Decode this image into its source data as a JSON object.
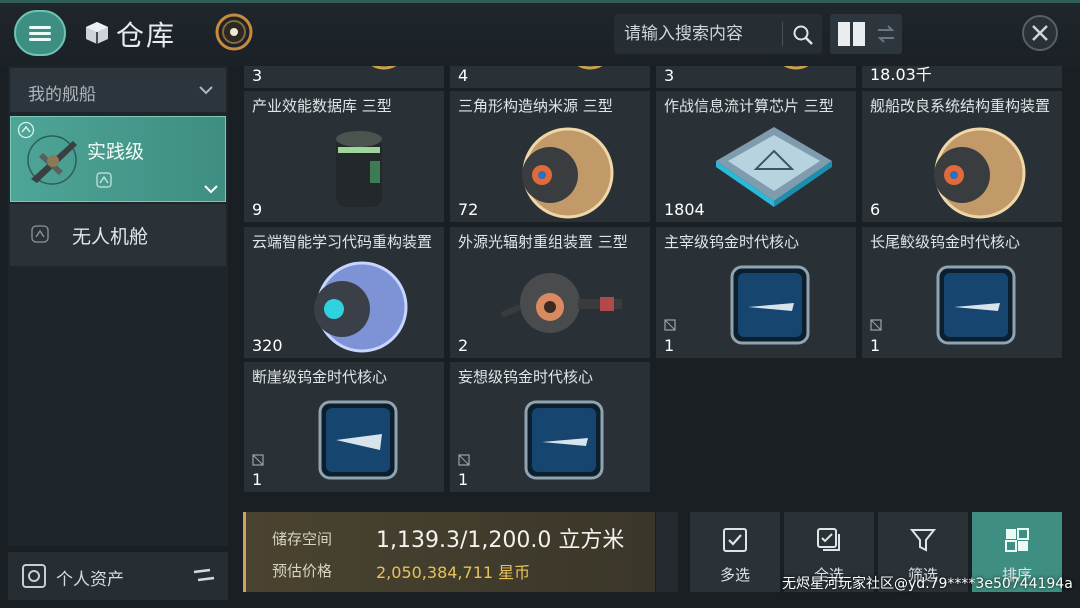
{
  "header": {
    "title": "仓库",
    "search_placeholder": "请输入搜索内容"
  },
  "sidebar": {
    "category_label": "我的舰船",
    "items": [
      {
        "label": "实践级",
        "selected": true
      },
      {
        "label": "无人机舱",
        "selected": false
      }
    ],
    "assets_label": "个人资产"
  },
  "grid": {
    "items": [
      {
        "name": "",
        "qty": "3"
      },
      {
        "name": "",
        "qty": "4"
      },
      {
        "name": "",
        "qty": "3"
      },
      {
        "name": "",
        "qty": "18.03千"
      },
      {
        "name": "产业效能数据库 三型",
        "qty": "9",
        "icon": "canister"
      },
      {
        "name": "三角形构造纳米源 三型",
        "qty": "72",
        "icon": "gold-sphere"
      },
      {
        "name": "作战信息流计算芯片 三型",
        "qty": "1804",
        "icon": "chip"
      },
      {
        "name": "舰船改良系统结构重构装置",
        "qty": "6",
        "icon": "gold-sphere"
      },
      {
        "name": "云端智能学习代码重构装置",
        "qty": "320",
        "icon": "blue-sphere"
      },
      {
        "name": "外源光辐射重组装置 三型",
        "qty": "2",
        "icon": "drone-pod"
      },
      {
        "name": "主宰级钨金时代核心",
        "qty": "1",
        "icon": "ship-core",
        "locked": true
      },
      {
        "name": "长尾鲛级钨金时代核心",
        "qty": "1",
        "icon": "ship-core",
        "locked": true
      },
      {
        "name": "断崖级钨金时代核心",
        "qty": "1",
        "icon": "ship-core",
        "locked": true
      },
      {
        "name": "妄想级钨金时代核心",
        "qty": "1",
        "icon": "ship-core",
        "locked": true
      }
    ]
  },
  "storage": {
    "capacity_label": "储存空间",
    "capacity_value": "1,139.3/1,200.0 立方米",
    "price_label": "预估价格",
    "price_value": "2,050,384,711 星币"
  },
  "actions": [
    {
      "label": "多选",
      "icon": "checkbox-icon"
    },
    {
      "label": "全选",
      "icon": "select-all-icon"
    },
    {
      "label": "筛选",
      "icon": "filter-icon"
    },
    {
      "label": "排序",
      "icon": "sort-icon",
      "active": true
    }
  ],
  "watermark": "无烬星河玩家社区@yd.79****3e50744194a",
  "colors": {
    "accent": "#3e8e81",
    "gold": "#e7c15c",
    "background": "#1a1f24"
  }
}
